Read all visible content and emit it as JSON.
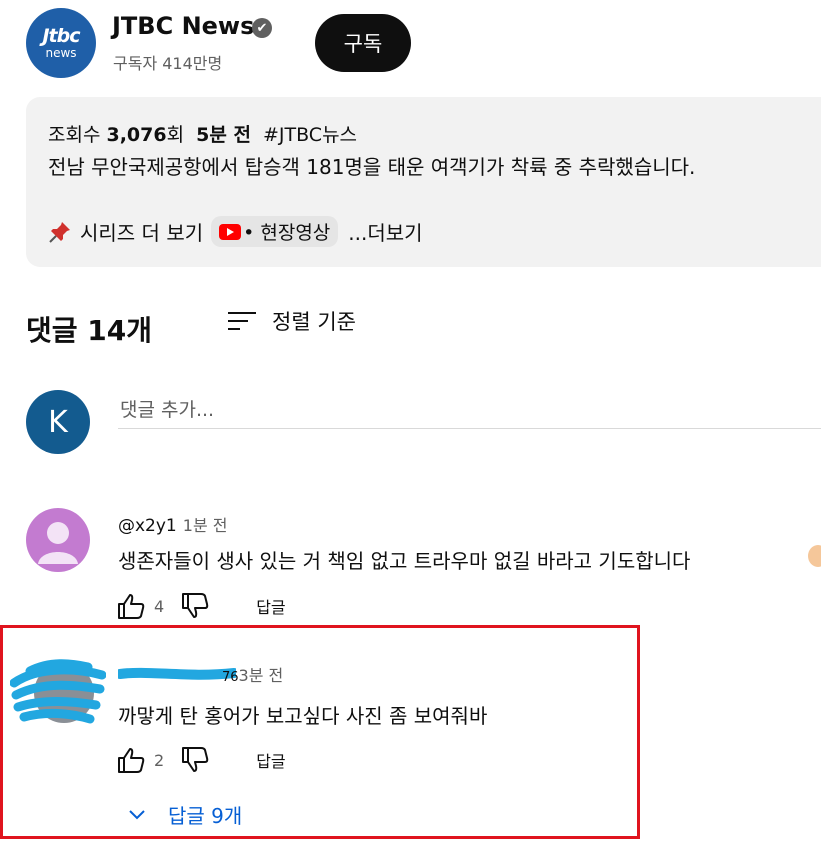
{
  "channel": {
    "avatar_line1": "Jtbc",
    "avatar_line2": "news",
    "name": "JTBC News",
    "verified_icon": "✔",
    "subscribers": "구독자 414만명",
    "subscribe_label": "구독"
  },
  "video": {
    "views_prefix": "조회수 ",
    "views": "3,076",
    "views_suffix": "회",
    "age": "5분 전",
    "hashtag": "#JTBC뉴스",
    "description": "전남 무안국제공항에서 탑승객 181명을 태운 여객기가 착륙 중 추락했습니다.",
    "series_label": "시리즈 더 보기",
    "chip_label": "• 현장영상",
    "more_label": "...더보기"
  },
  "comments": {
    "title": "댓글 14개",
    "sort_label": "정렬 기준",
    "add": {
      "avatar_letter": "K",
      "placeholder": "댓글 추가..."
    },
    "items": [
      {
        "author": "@x2y1",
        "time": "1분 전",
        "text": "생존자들이 생사 있는 거 책임 없고 트라우마 없길 바라고 기도합니다",
        "likes": "4",
        "reply_label": "답글"
      },
      {
        "author_partial": "76",
        "time": "3분 전",
        "text": "까맣게 탄 홍어가 보고싶다 사진 좀 보여줘바",
        "likes": "2",
        "reply_label": "답글",
        "replies_toggle": "답글 9개"
      }
    ]
  },
  "colors": {
    "highlight_border": "#e0141e",
    "link_blue": "#065fd4",
    "redaction_blue": "#22a7e0",
    "subscribe_bg": "#0f0f0f"
  }
}
